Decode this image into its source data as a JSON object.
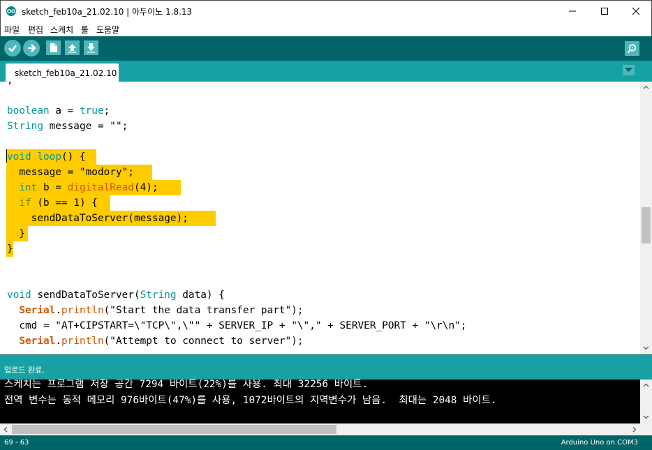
{
  "window": {
    "title": "sketch_feb10a_21.02.10 | 아두이노 1.8.13",
    "icon": "arduino-icon"
  },
  "menu": [
    "파일",
    "편집",
    "스케치",
    "툴",
    "도움말"
  ],
  "toolbar": {
    "buttons": [
      "verify-icon",
      "upload-icon",
      "new-icon",
      "open-icon",
      "save-icon",
      "serial-monitor-icon"
    ]
  },
  "tabs": [
    {
      "label": "sketch_feb10a_21.02.10",
      "active": true
    }
  ],
  "editor": {
    "highlight_color": "#ffcc00",
    "lines": [
      ";",
      "",
      "boolean a = true;",
      "String message = \"\";",
      "",
      "void loop() {",
      "  message = \"modory\";",
      "  int b = digitalRead(4);",
      "  if (b == 1) {",
      "    sendDataToServer(message);",
      "  }",
      "}",
      "",
      "",
      "void sendDataToServer(String data) {",
      "  Serial.println(\"Start the data transfer part\");",
      "  cmd = \"AT+CIPSTART=\\\"TCP\\\",\\\"\" + SERVER_IP + \"\\\",\" + SERVER_PORT + \"\\r\\n\";",
      "  Serial.println(\"Attempt to connect to server\");"
    ]
  },
  "status_message": "업로드 완료.",
  "console": {
    "lines": [
      "스케치는 프로그램 저장 공간 7294 바이트(22%)를 사용. 최대 32256 바이트.",
      "전역 변수는 동적 메모리 976바이트(47%)를 사용, 1072바이트의 지역변수가 남음.  최대는 2048 바이트."
    ]
  },
  "statusbar": {
    "line_info": "69 - 63",
    "board": "Arduino Uno on COM3"
  },
  "colors": {
    "toolbar": "#006468",
    "tabstrip": "#17a1a5",
    "button": "#4db7bb",
    "keyword_type": "#00979c",
    "keyword_function": "#d35400",
    "keyword_control": "#728e00"
  }
}
